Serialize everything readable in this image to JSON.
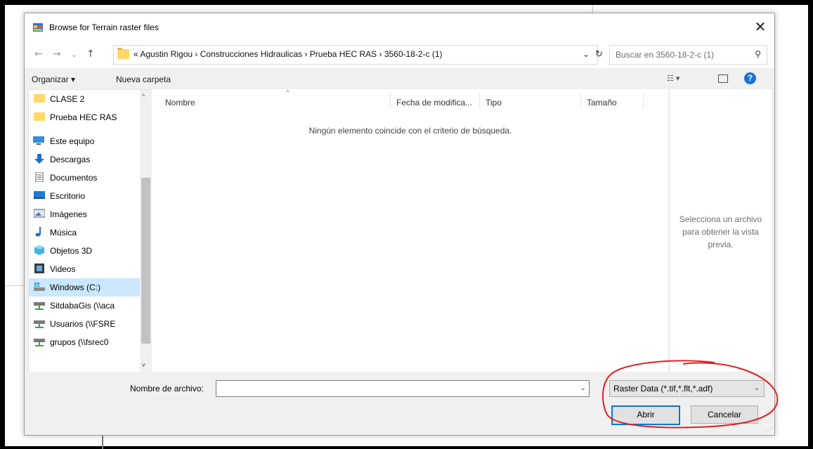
{
  "window": {
    "title": "Browse for Terrain raster files",
    "close_glyph": "✕"
  },
  "address": {
    "back_glyph": "←",
    "forward_glyph": "→",
    "recent_glyph": "⌄",
    "up_glyph": "↑",
    "path": "« Agustin Rigou  ›  Construcciones Hidraulicas  ›  Prueba HEC RAS  ›  3560-18-2-c (1)",
    "dropdown_glyph": "⌄",
    "refresh_glyph": "↻",
    "search_placeholder": "Buscar en 3560-18-2-c (1)",
    "search_glyph": "⚲"
  },
  "toolbar": {
    "organize_label": "Organizar ▾",
    "new_folder_label": "Nueva carpeta",
    "view_glyph": "☷ ▾",
    "help_glyph": "?"
  },
  "nav_pane": {
    "items": [
      {
        "label": "CLASE 2",
        "icon": "folder-icon"
      },
      {
        "label": "Prueba HEC RAS",
        "icon": "folder-icon"
      },
      {
        "label": "Este equipo",
        "icon": "computer-icon"
      },
      {
        "label": "Descargas",
        "icon": "download-icon"
      },
      {
        "label": "Documentos",
        "icon": "document-icon"
      },
      {
        "label": "Escritorio",
        "icon": "desktop-icon"
      },
      {
        "label": "Imágenes",
        "icon": "pictures-icon"
      },
      {
        "label": "Música",
        "icon": "music-icon"
      },
      {
        "label": "Objetos 3D",
        "icon": "objects3d-icon"
      },
      {
        "label": "Videos",
        "icon": "videos-icon"
      },
      {
        "label": "Windows (C:)",
        "icon": "drive-icon"
      },
      {
        "label": "SitdabaGis (\\\\aca",
        "icon": "network-drive-icon"
      },
      {
        "label": "Usuarios (\\\\FSRE",
        "icon": "network-drive-icon"
      },
      {
        "label": "grupos (\\\\fsrec0",
        "icon": "network-drive-icon"
      }
    ],
    "scroll_up_glyph": "^",
    "scroll_down_glyph": "v"
  },
  "file_list": {
    "columns": [
      "Nombre",
      "Fecha de modifica...",
      "Tipo",
      "Tamaño"
    ],
    "sort_glyph": "^",
    "empty_message": "Ningún elemento coincide con el criterio de búsqueda."
  },
  "preview": {
    "text_line1": "Selecciona un archivo",
    "text_line2": "para obtener la vista",
    "text_line3": "previa."
  },
  "bottom": {
    "filename_label": "Nombre de archivo:",
    "filename_value": "",
    "filename_caret": "⌄",
    "filter_label": "Raster Data (*.tif,*.flt,*.adf)",
    "filter_caret": "⌄",
    "open_label": "Abrir",
    "cancel_label": "Cancelar",
    "grip_glyph": "⋰"
  },
  "colors": {
    "accent": "#0078d7",
    "selection": "#cce8ff",
    "annotation_red": "#e02020",
    "help_blue": "#1a73d3"
  }
}
